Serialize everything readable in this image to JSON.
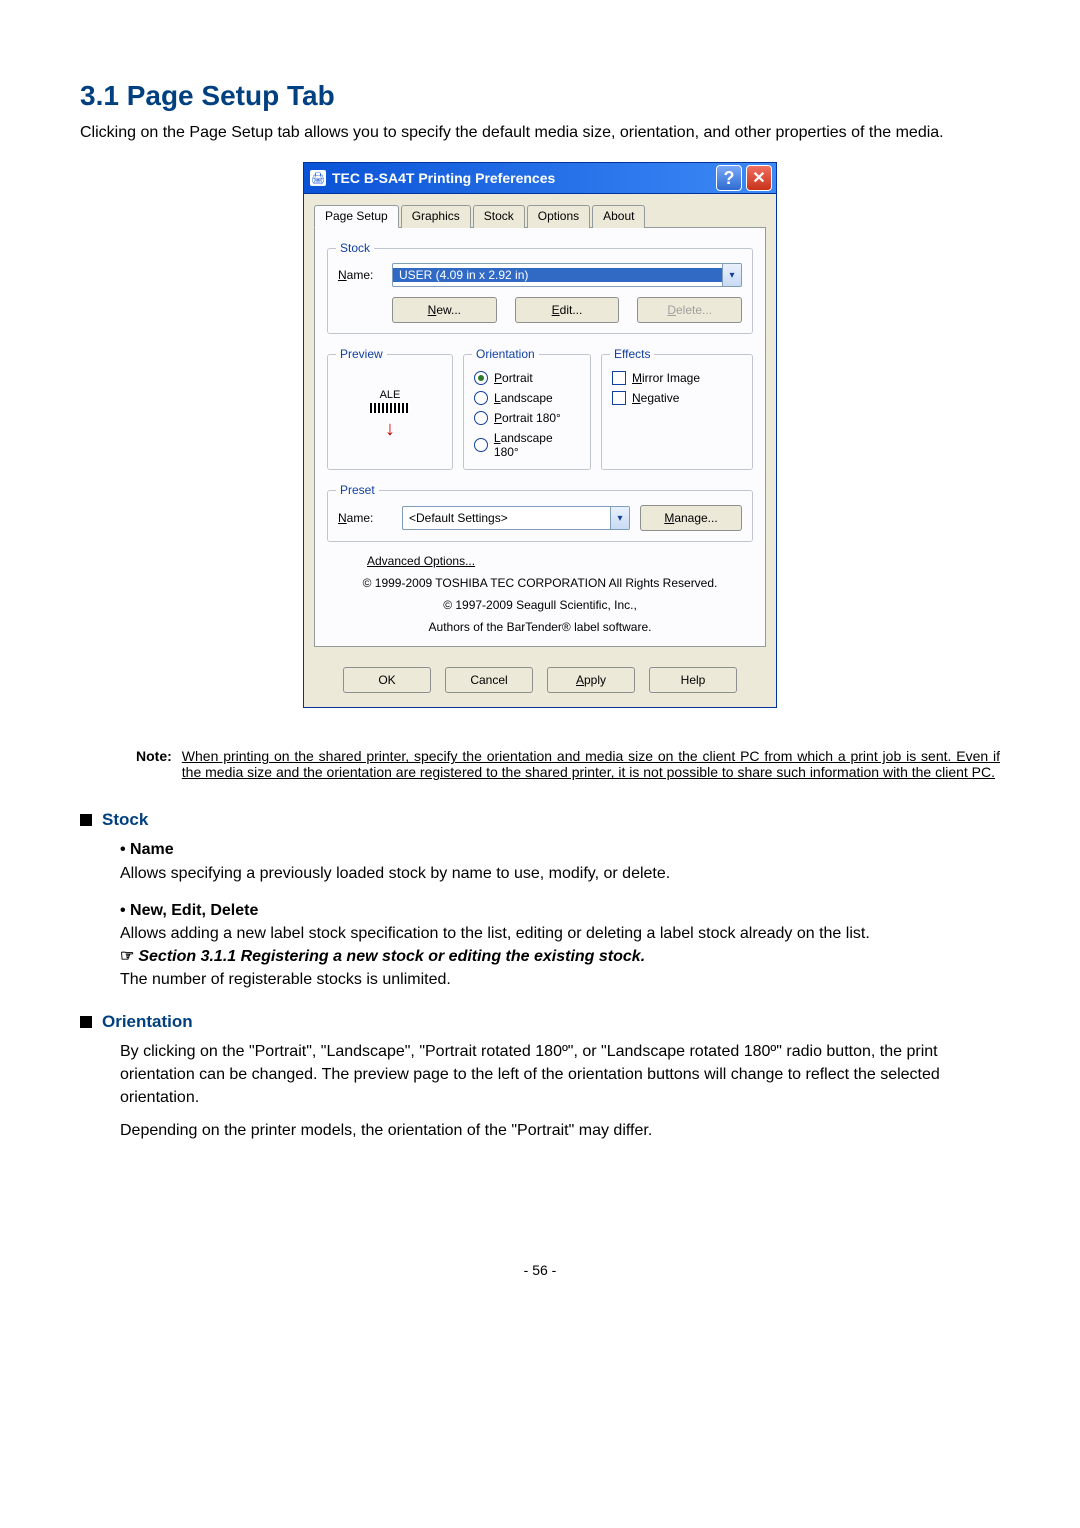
{
  "heading": "3.1  Page  Setup  Tab",
  "intro": "Clicking on the Page Setup tab allows you to specify the default media size, orientation, and other properties of the media.",
  "dialog": {
    "title": "TEC B-SA4T Printing Preferences",
    "tabs": [
      "Page Setup",
      "Graphics",
      "Stock",
      "Options",
      "About"
    ],
    "active_tab": "Page Setup",
    "stock": {
      "legend": "Stock",
      "name_label": "Name:",
      "name_value": "USER (4.09 in x 2.92 in)",
      "buttons": {
        "new": "New...",
        "edit": "Edit...",
        "delete": "Delete..."
      }
    },
    "preview": {
      "legend": "Preview",
      "sample_text": "ALE"
    },
    "orientation": {
      "legend": "Orientation",
      "options": [
        "Portrait",
        "Landscape",
        "Portrait 180°",
        "Landscape 180°"
      ],
      "selected": "Portrait"
    },
    "effects": {
      "legend": "Effects",
      "options": [
        "Mirror Image",
        "Negative"
      ]
    },
    "preset": {
      "legend": "Preset",
      "name_label": "Name:",
      "value": "<Default Settings>",
      "manage": "Manage..."
    },
    "advanced": "Advanced Options...",
    "copyright1": "© 1999-2009 TOSHIBA TEC CORPORATION All Rights Reserved.",
    "copyright2": "© 1997-2009 Seagull Scientific, Inc.,",
    "copyright3": "Authors of the BarTender® label software.",
    "buttons": {
      "ok": "OK",
      "cancel": "Cancel",
      "apply": "Apply",
      "help": "Help"
    }
  },
  "note": {
    "label": "Note:",
    "text": "When printing on the shared printer, specify the orientation and media size on the client PC from which a print job is sent.   Even if the media size and the orientation are registered to the shared printer, it is not possible to share such information with the client PC."
  },
  "sections": {
    "stock": {
      "title": "Stock",
      "items": [
        {
          "title": "Name",
          "body": "Allows specifying a previously loaded stock by name to use, modify, or delete."
        },
        {
          "title": "New, Edit, Delete",
          "body": "Allows adding a new label stock specification to the list, editing or deleting a label stock already on the list.",
          "linkref": "Section 3.1.1 Registering a new stock or editing the existing stock.",
          "body2": "The number of registerable stocks is unlimited."
        }
      ]
    },
    "orientation": {
      "title": "Orientation",
      "para1": "By clicking on the \"Portrait\", \"Landscape\", \"Portrait rotated 180º\", or \"Landscape rotated 180º\" radio button, the print orientation can be changed.   The preview page to the left of the orientation buttons will change to reflect the selected orientation.",
      "para2": "Depending on the printer models, the orientation of the \"Portrait\" may differ."
    }
  },
  "page_number": "- 56 -"
}
